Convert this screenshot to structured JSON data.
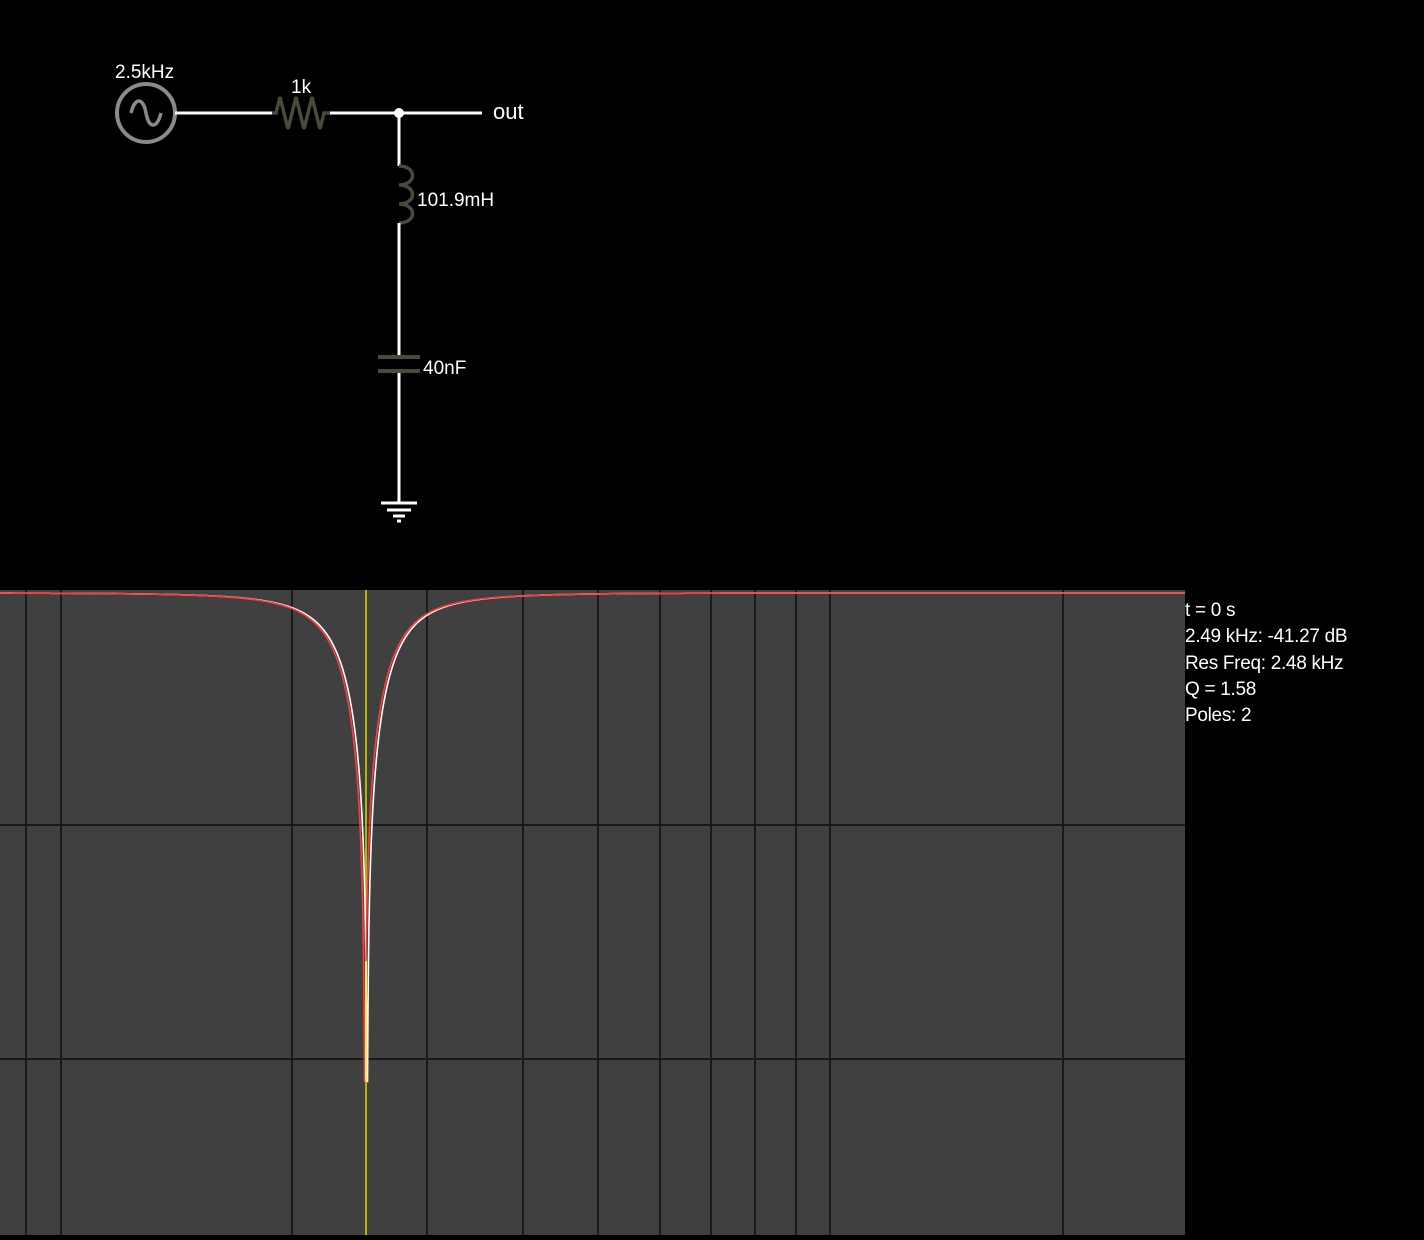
{
  "circuit": {
    "source_label": "2.5kHz",
    "resistor_label": "1k",
    "output_label": "out",
    "inductor_label": "101.9mH",
    "capacitor_label": "40nF"
  },
  "scope": {
    "info": {
      "time": "t = 0 s",
      "cursor_reading": "2.49 kHz: -41.27 dB",
      "res_freq": "Res Freq: 2.48 kHz",
      "q": "Q = 1.58",
      "poles": "Poles: 2"
    },
    "colors": {
      "background": "#404040",
      "grid": "#1a1a1a",
      "cursor": "#b5b500",
      "trace_primary": "#ff3b3b",
      "trace_secondary": "#ffffff",
      "trace_notch": "#ffee66"
    }
  },
  "chart_data": {
    "type": "line",
    "x_scale": "log",
    "resonant_frequency_khz": 2.48,
    "cursor_frequency_khz": 2.49,
    "q": 1.58,
    "notch_depth_db": -41.27
  }
}
